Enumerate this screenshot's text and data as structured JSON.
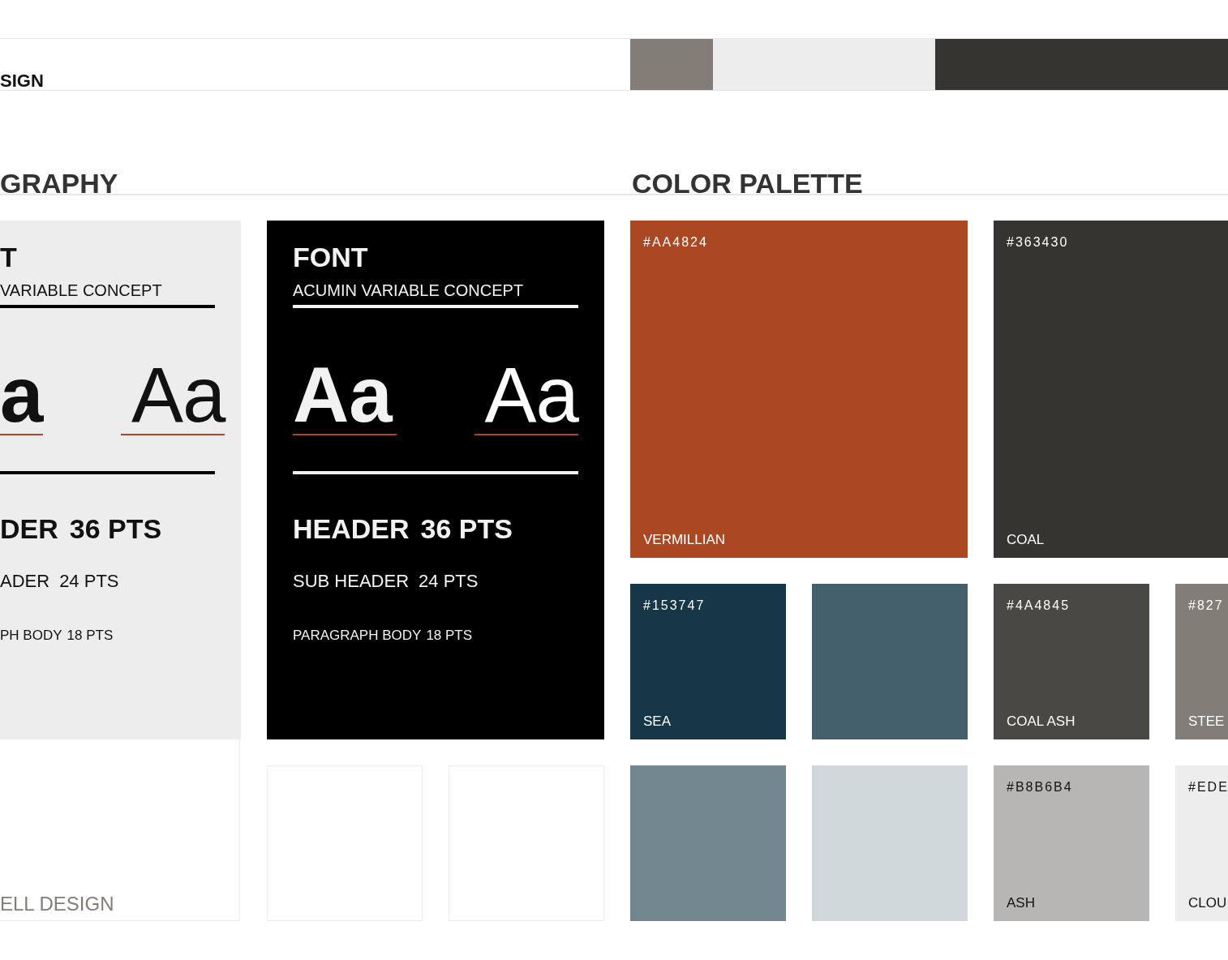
{
  "band": {
    "title": "SIGN",
    "swatches": [
      {
        "color": "#827d76"
      },
      {
        "color": "#ededed"
      },
      {
        "color": "#363430"
      }
    ]
  },
  "typography": {
    "heading": "GRAPHY",
    "cards": [
      {
        "kind": "light",
        "title": "T",
        "font_name": "VARIABLE CONCEPT",
        "sample_bold": "a",
        "sample_light": "Aa",
        "header": "DER",
        "header_size": "36 PTS",
        "sub_header": "ADER",
        "sub_header_size": "24 PTS",
        "body": "PH BODY",
        "body_size": "18 PTS"
      },
      {
        "kind": "dark",
        "title": "FONT",
        "font_name": "ACUMIN VARIABLE CONCEPT",
        "sample_bold": "Aa",
        "sample_light": "Aa",
        "header": "HEADER",
        "header_size": "36 PTS",
        "sub_header": "SUB HEADER",
        "sub_header_size": "24 PTS",
        "body": "PARAGRAPH BODY",
        "body_size": "18 PTS"
      }
    ],
    "footer_text": "ELL DESIGN"
  },
  "palette": {
    "heading": "COLOR PALETTE",
    "groups": [
      {
        "swatches": [
          {
            "kind": "large",
            "color": "#aa4824",
            "code": "#AA4824",
            "name": "VERMILLIAN"
          },
          {
            "kind": "small",
            "color": "#153747",
            "code": "#153747",
            "name": "SEA"
          },
          {
            "kind": "small",
            "color": "#45606d"
          },
          {
            "kind": "small",
            "color": "#738790"
          },
          {
            "kind": "small",
            "color": "#d0d7da"
          }
        ]
      },
      {
        "swatches": [
          {
            "kind": "large",
            "color": "#363430",
            "code": "#363430",
            "name": "COAL"
          },
          {
            "kind": "small",
            "color": "#4a4845",
            "code": "#4A4845",
            "name": "COAL ASH"
          },
          {
            "kind": "small",
            "color": "#827d76",
            "code": "#827",
            "name": "STEE"
          },
          {
            "kind": "small",
            "color": "#b8b6b4",
            "code": "#B8B6B4",
            "name": "ASH"
          },
          {
            "kind": "small",
            "color": "#ededed",
            "code": "#EDE",
            "name": "CLOU"
          }
        ]
      }
    ]
  }
}
